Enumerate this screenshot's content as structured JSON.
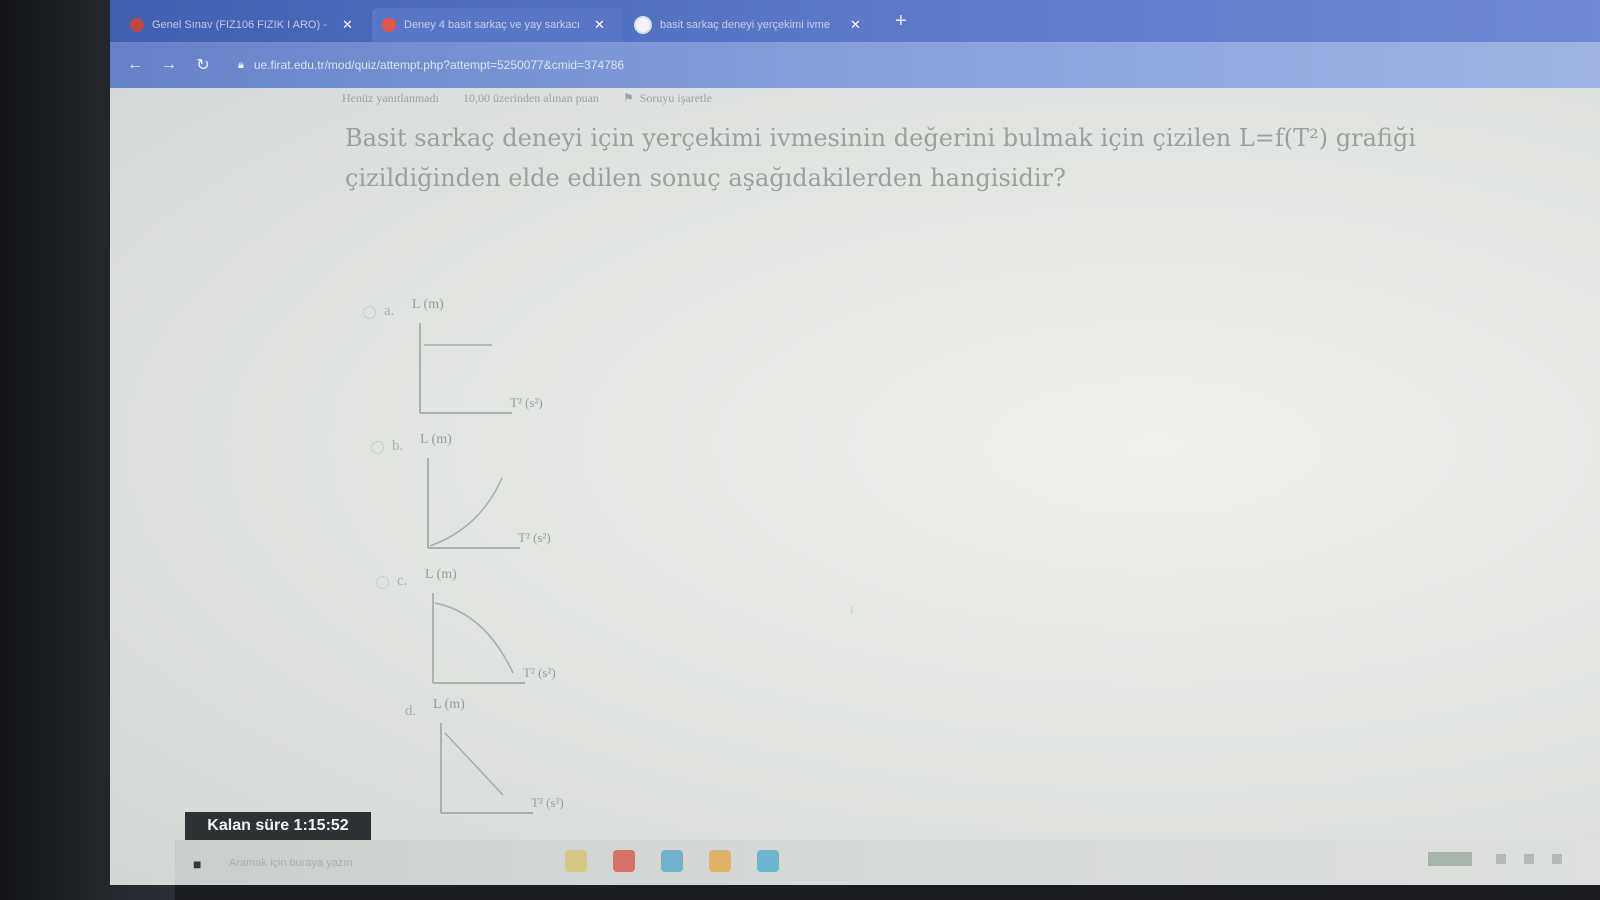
{
  "browser": {
    "tabs": [
      {
        "label": "Genel Sınav (FIZ106 FIZIK I ARO) -",
        "favicon_color": "#c0463a"
      },
      {
        "label": "Deney 4 basit sarkaç ve yay sarkacı",
        "favicon_color": "#e8534a"
      },
      {
        "label": "basit sarkaç deneyi yerçekimi ivme",
        "favicon_color": "#f3f3f3"
      }
    ],
    "new_tab_label": "+",
    "url": "ue.firat.edu.tr/mod/quiz/attempt.php?attempt=5250077&cmid=374786"
  },
  "quiz": {
    "status": "Henüz yanıtlanmadı",
    "points": "10,00 üzerinden alınan puan",
    "flag": "Soruyu işaretle",
    "question_line1": "Basit sarkaç deneyi için yerçekimi ivmesinin değerini bulmak için çizilen L=f(T²) grafiği",
    "question_line2": "çizildiğinden elde edilen sonuç aşağıdakilerden hangisidir?",
    "options": [
      {
        "letter": "a.",
        "y_label": "L (m)",
        "x_label": "T² (s²)",
        "curve": "horizontal"
      },
      {
        "letter": "b.",
        "y_label": "L (m)",
        "x_label": "T² (s²)",
        "curve": "increasing-convex"
      },
      {
        "letter": "c.",
        "y_label": "L (m)",
        "x_label": "T² (s²)",
        "curve": "decreasing-concave"
      },
      {
        "letter": "d.",
        "y_label": "L (m)",
        "x_label": "T² (s²)",
        "curve": "decreasing-linear"
      }
    ]
  },
  "timer": {
    "label": "Kalan süre 1:15:52"
  },
  "taskbar": {
    "search_placeholder": "Aramak için buraya yazın"
  },
  "colors": {
    "tabbar": "#4a68b8",
    "timer_bg": "#2e3234",
    "text_muted": "#98a29d"
  }
}
